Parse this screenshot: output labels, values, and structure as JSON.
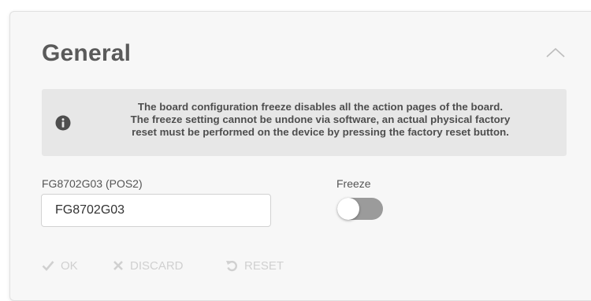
{
  "section": {
    "title": "General",
    "collapse_icon": "chevron-up-icon"
  },
  "info": {
    "icon": "info-circle-icon",
    "line1": "The board configuration freeze disables all the action pages of the board.",
    "line2": "The freeze setting cannot be undone via software, an actual physical factory",
    "line3": "reset must be performed on the device by pressing the factory reset button."
  },
  "name_field": {
    "label": "FG8702G03 (POS2)",
    "value": "FG8702G03"
  },
  "freeze": {
    "label": "Freeze",
    "checked": false
  },
  "actions": {
    "ok_label": "OK",
    "discard_label": "DISCARD",
    "reset_label": "RESET",
    "ok_icon": "check-icon",
    "discard_icon": "x-icon",
    "reset_icon": "undo-icon",
    "color_disabled": "#d0d0d0"
  },
  "colors": {
    "card_bg": "#f7f7f7",
    "info_bg": "#e7e7e7",
    "toggle_off": "#9b9b9b"
  }
}
